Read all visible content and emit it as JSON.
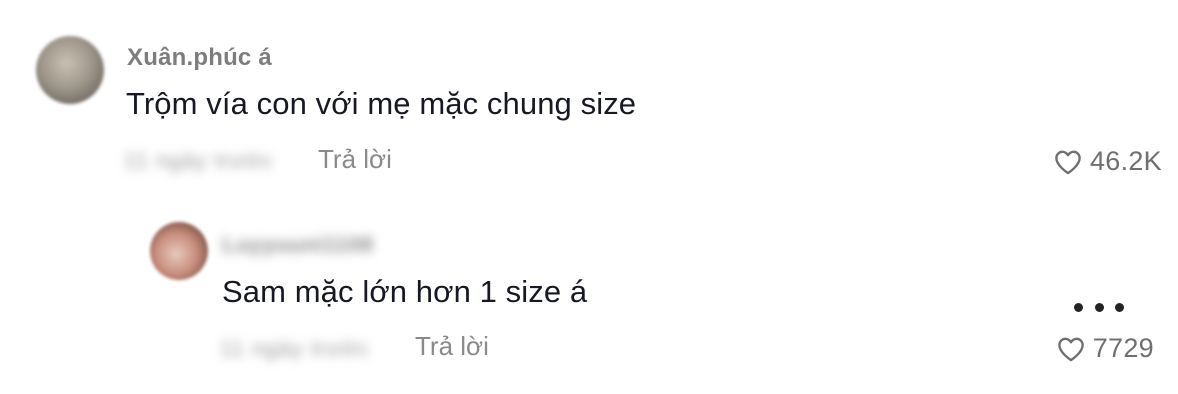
{
  "comment": {
    "username": "Xuân.phúc á",
    "text": "Trộm vía con với mẹ mặc chung size",
    "date": "11 ngày trước",
    "reply_label": "Trả lời",
    "like_count": "46.2K",
    "like_icon": "heart-outline-icon"
  },
  "reply": {
    "username": "Luyyuuni1108",
    "text": "Sam mặc lớn hơn 1 size á",
    "date": "11 ngày trước",
    "reply_label": "Trả lời",
    "like_count": "7729",
    "like_icon": "heart-outline-icon",
    "more_icon": "more-options-icon"
  },
  "colors": {
    "text_primary": "#161823",
    "text_secondary": "#8a8a8a",
    "background": "#ffffff"
  }
}
